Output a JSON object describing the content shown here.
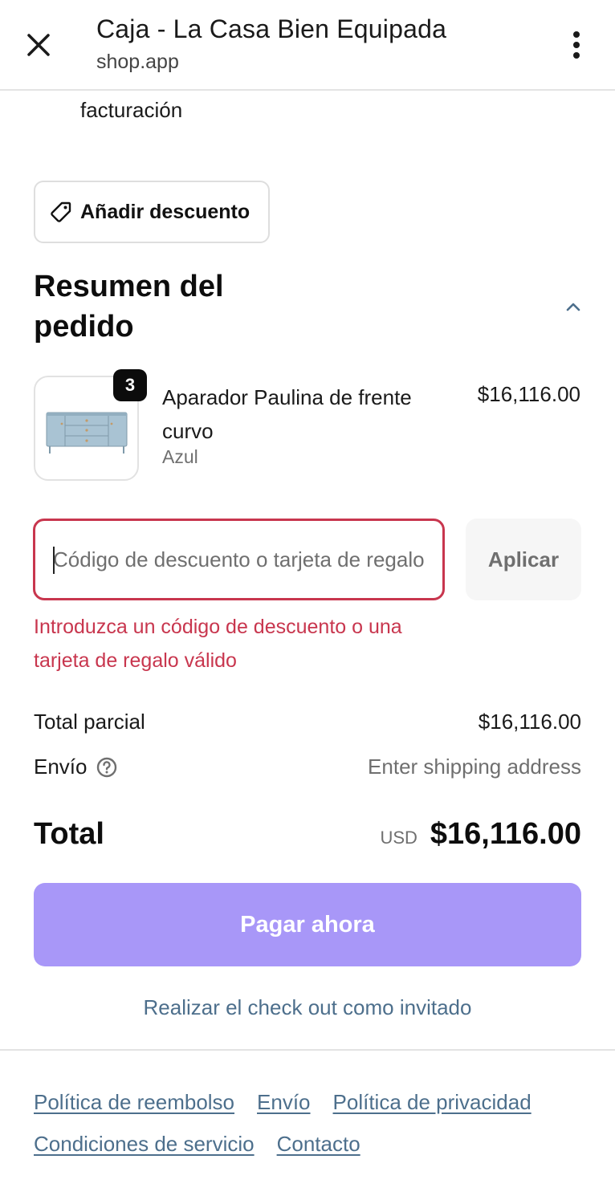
{
  "browser": {
    "title": "Caja - La Casa Bien Equipada",
    "subtitle": "shop.app",
    "close_icon": "close-icon",
    "menu_icon": "more-vert-icon"
  },
  "checkout": {
    "billing_fragment": "facturación",
    "discount_toggle_label": "Añadir descuento",
    "summary_title": "Resumen del pedido",
    "product": {
      "name": "Aparador Paulina de frente curvo",
      "variant": "Azul",
      "price": "$16,116.00",
      "quantity": "3"
    },
    "discount_input_placeholder": "Código de descuento o tarjeta de regalo",
    "apply_label": "Aplicar",
    "error_message": "Introduzca un código de descuento o una tarjeta de regalo válido",
    "subtotal_label": "Total parcial",
    "subtotal_value": "$16,116.00",
    "shipping_label": "Envío",
    "shipping_value": "Enter shipping address",
    "total_label": "Total",
    "total_currency": "USD",
    "total_value": "$16,116.00",
    "pay_label": "Pagar ahora",
    "guest_label": "Realizar el check out como invitado"
  },
  "footer": {
    "links": [
      "Política de reembolso",
      "Envío",
      "Política de privacidad",
      "Condiciones de servicio",
      "Contacto"
    ]
  },
  "colors": {
    "error": "#c8364e",
    "pay_button": "#a897f8",
    "link": "#4d6f8c"
  }
}
